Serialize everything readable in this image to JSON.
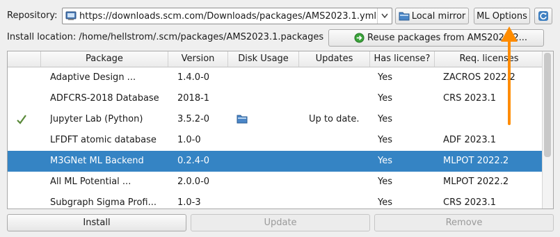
{
  "repository": {
    "label": "Repository:",
    "url": "https://downloads.scm.com/Downloads/packages/AMS2023.1.yml"
  },
  "install_location": {
    "label": "Install location:",
    "path": "/home/hellstrom/.scm/packages/AMS2023.1.packages"
  },
  "buttons": {
    "local_mirror": "Local mirror",
    "ml_options": "ML Options",
    "reuse": "Reuse packages from AMS2022.2...",
    "install": "Install",
    "update": "Update",
    "remove": "Remove"
  },
  "table": {
    "columns": [
      "",
      "Package",
      "Version",
      "Disk Usage",
      "Updates",
      "Has license?",
      "Req. licenses"
    ],
    "rows": [
      {
        "installed": false,
        "package": "Adaptive Design ...",
        "version": "1.4.0-0",
        "disk": false,
        "updates": "",
        "license": "Yes",
        "req": "ZACROS 2022.2",
        "selected": false
      },
      {
        "installed": false,
        "package": "ADFCRS-2018 Database",
        "version": "2018-1",
        "disk": false,
        "updates": "",
        "license": "Yes",
        "req": "CRS 2023.1",
        "selected": false
      },
      {
        "installed": true,
        "package": "Jupyter Lab (Python)",
        "version": "3.5.2-0",
        "disk": true,
        "updates": "Up to date.",
        "license": "Yes",
        "req": "",
        "selected": false
      },
      {
        "installed": false,
        "package": "LFDFT atomic database",
        "version": "1.0-0",
        "disk": false,
        "updates": "",
        "license": "Yes",
        "req": "ADF 2023.1",
        "selected": false
      },
      {
        "installed": false,
        "package": "M3GNet ML Backend",
        "version": "0.2.4-0",
        "disk": false,
        "updates": "",
        "license": "Yes",
        "req": "MLPOT 2022.2",
        "selected": true
      },
      {
        "installed": false,
        "package": "All ML Potential ...",
        "version": "2.0.0-0",
        "disk": false,
        "updates": "",
        "license": "Yes",
        "req": "MLPOT 2022.2",
        "selected": false
      },
      {
        "installed": false,
        "package": "Subgraph Sigma Profi...",
        "version": "1.0-3",
        "disk": false,
        "updates": "",
        "license": "Yes",
        "req": "CRS 2023.1",
        "selected": false
      }
    ]
  },
  "colors": {
    "selection": "#3584c4",
    "annotation_arrow": "#ff8c00",
    "check": "#5a8a3a"
  }
}
